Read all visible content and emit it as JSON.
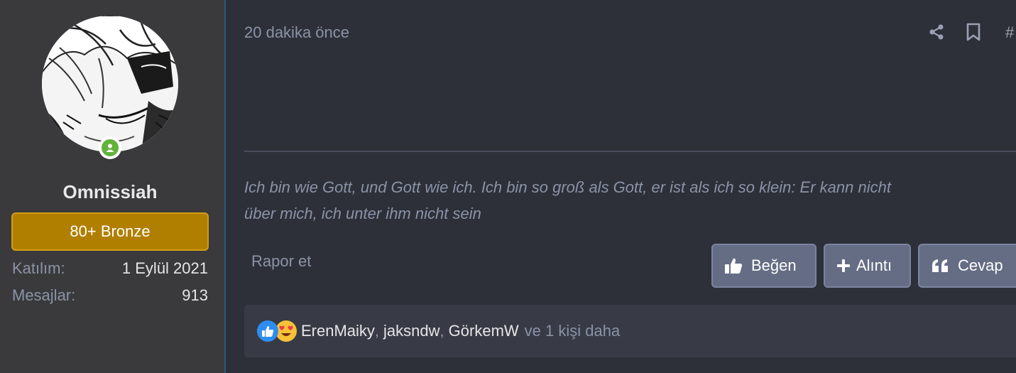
{
  "author": {
    "username": "Omnissiah",
    "rank": "80+ Bronze",
    "stats": [
      {
        "key": "Katılım:",
        "value": "1 Eylül 2021"
      },
      {
        "key": "Mesajlar:",
        "value": "913"
      }
    ],
    "online_color": "#63b23a"
  },
  "post": {
    "timestamp": "20 dakika önce",
    "hash": "#",
    "signature_line1": "Ich bin wie Gott, und Gott wie ich. Ich bin so groß als Gott, er ist als ich so klein: Er kann nicht",
    "signature_line2": "über mich, ich unter ihm nicht sein",
    "report_label": "Rapor et"
  },
  "actions": {
    "like_label": "Beğen",
    "quote_label": "Alıntı",
    "reply_label": "Cevap"
  },
  "reactions": {
    "users": [
      "ErenMaiky",
      "jaksndw",
      "GörkemW"
    ],
    "separator": ",",
    "more_text": "ve 1 kişi daha"
  },
  "colors": {
    "accent_rank": "#b07f00",
    "button_bg": "#656d85",
    "like_blue": "#2e8df0"
  }
}
